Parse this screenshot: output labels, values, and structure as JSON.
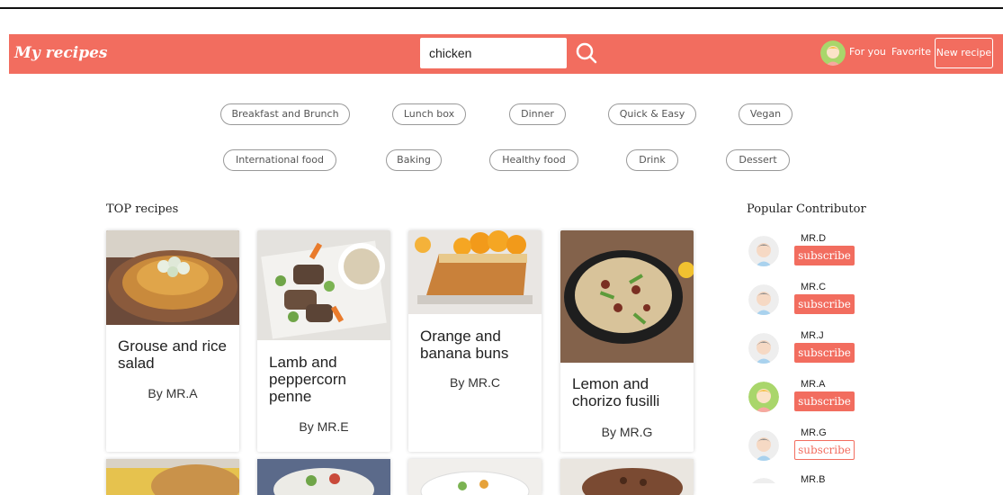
{
  "header": {
    "brand": "My recipes",
    "search_value": "chicken",
    "nav_for_you": "For you",
    "nav_favorite": "Favorite",
    "new_recipe": "New recipe"
  },
  "categories": [
    "Breakfast and Brunch",
    "Lunch box",
    "Dinner",
    "Quick & Easy",
    "Vegan",
    "International food",
    "Baking",
    "Healthy food",
    "Drink",
    "Dessert"
  ],
  "top_recipes": {
    "title": "TOP recipes",
    "cards": [
      {
        "title": "Grouse and rice salad",
        "author": "By MR.A"
      },
      {
        "title": "Lamb and peppercorn penne",
        "author": "By MR.E"
      },
      {
        "title": "Orange and banana buns",
        "author": "By MR.C"
      },
      {
        "title": "Lemon and chorizo fusilli",
        "author": "By MR.G"
      }
    ]
  },
  "contributors": {
    "title": "Popular Contributor",
    "subscribe_label": "subscribe",
    "items": [
      {
        "name": "MR.D"
      },
      {
        "name": "MR.C"
      },
      {
        "name": "MR.J"
      },
      {
        "name": "MR.A"
      },
      {
        "name": "MR.G"
      },
      {
        "name": "MR.B"
      }
    ]
  },
  "colors": {
    "accent": "#f26d5f"
  }
}
